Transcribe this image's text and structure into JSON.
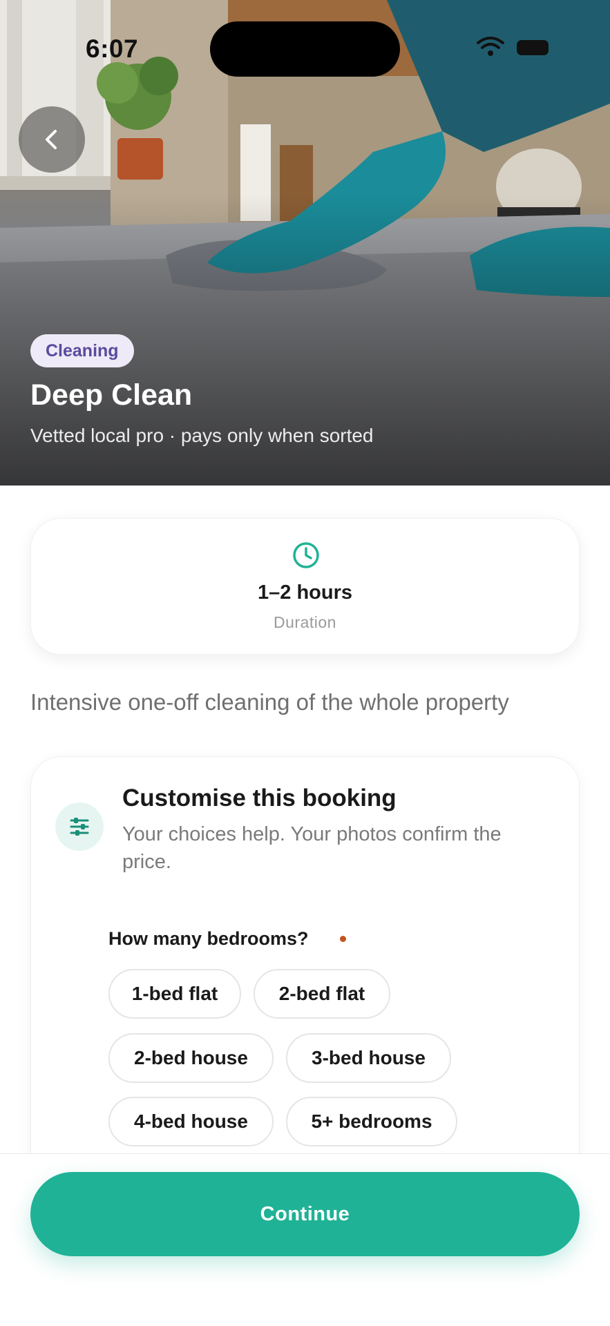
{
  "status_bar": {
    "time": "6:07"
  },
  "hero": {
    "category": "Cleaning",
    "title": "Deep Clean",
    "subtitle": "Vetted local pro · pays only when sorted",
    "back_icon": "chevron-left-icon"
  },
  "duration": {
    "icon": "clock-icon",
    "value": "1–2 hours",
    "label": "Duration"
  },
  "description": "Intensive one-off cleaning of the whole property",
  "customise": {
    "icon": "sliders-icon",
    "title": "Customise this booking",
    "subtitle": "Your choices help. Your photos confirm the price.",
    "question": "How many bedrooms?",
    "options": [
      "1-bed flat",
      "2-bed flat",
      "2-bed house",
      "3-bed house",
      "4-bed house",
      "5+ bedrooms"
    ]
  },
  "footer": {
    "continue_label": "Continue"
  },
  "colors": {
    "accent": "#1fb296",
    "badge_text": "#5b4a9e",
    "required": "#c4541d"
  }
}
